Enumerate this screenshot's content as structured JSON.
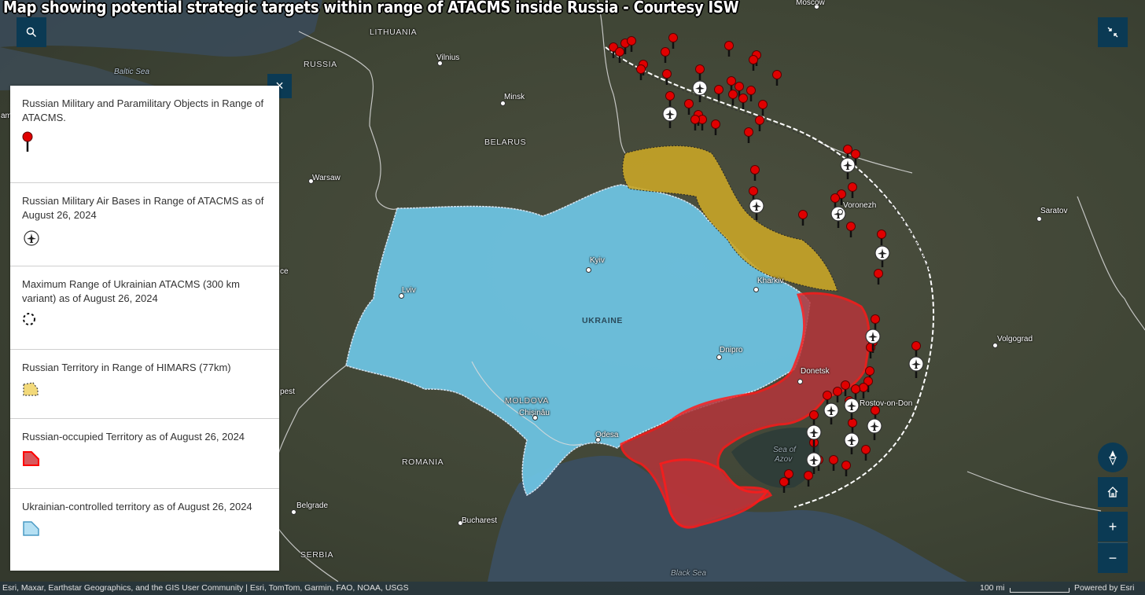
{
  "header": {
    "title": "Map showing potential strategic targets within range of ATACMS inside Russia - Courtesy ISW"
  },
  "legend": {
    "items": [
      {
        "label": "Russian Military and Paramilitary Objects in Range of ATACMS.",
        "icon": "red-pin-icon"
      },
      {
        "label": "Russian Military Air Bases in Range of ATACMS as of August 26, 2024",
        "icon": "airplane-icon"
      },
      {
        "label": "Maximum Range of Ukrainian ATACMS (300 km variant) as of August 26, 2024",
        "icon": "dashed-circle-icon"
      },
      {
        "label": "Russian Territory in Range of HIMARS (77km)",
        "icon": "yellow-polygon-icon"
      },
      {
        "label": "Russian-occupied Territory as of August 26, 2024",
        "icon": "red-polygon-icon"
      },
      {
        "label": "Ukrainian-controlled territory as of August 26, 2024",
        "icon": "blue-polygon-icon"
      }
    ],
    "close_label": "×"
  },
  "controls": {
    "zoom_in": "+",
    "zoom_out": "−"
  },
  "map_labels": {
    "moscow": "Moscow",
    "lithuania": "LITHUANIA",
    "russia": "RUSSIA",
    "vilnius": "Vilnius",
    "baltic_sea": "Baltic Sea",
    "minsk": "Minsk",
    "belarus": "BELARUS",
    "warsaw": "Warsaw",
    "kyiv": "Kyiv",
    "lviv": "Lviv",
    "ukraine": "UKRAINE",
    "kharkiv": "Kharkiv",
    "dnipro": "Dnipro",
    "donetsk": "Donetsk",
    "voronezh": "Voronezh",
    "saratov": "Saratov",
    "volgograd": "Volgograd",
    "rostov": "Rostov-on-Don",
    "moldova": "MOLDOVA",
    "chisinau": "Chișinău",
    "odesa": "Odesa",
    "romania": "ROMANIA",
    "belgrade": "Belgrade",
    "bucharest": "Bucharest",
    "serbia": "SERBIA",
    "sea_of_azov_1": "Sea of",
    "sea_of_azov_2": "Azov",
    "black_sea": "Black Sea",
    "budapest": "pest",
    "am": "am",
    "ce": "ce"
  },
  "attribution": {
    "text": "Esri, Maxar, Earthstar Geographics, and the GIS User Community | Esri, TomTom, Garmin, FAO, NOAA, USGS",
    "scale": "100 mi",
    "powered": "Powered by Esri"
  },
  "colors": {
    "ukraine": "#6ec6e6",
    "occupied": "#b5353a",
    "himars": "#c8a527",
    "pin": "#e00000",
    "panel": "#0b3a54"
  }
}
